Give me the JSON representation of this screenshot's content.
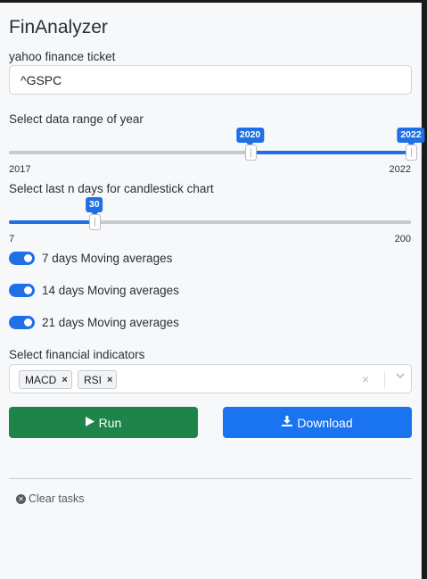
{
  "app": {
    "title": "FinAnalyzer"
  },
  "ticker": {
    "label": "yahoo finance ticket",
    "value": "^GSPC"
  },
  "year_range": {
    "label": "Select data range of year",
    "min": 2017,
    "max": 2022,
    "value_low": 2020,
    "value_high": 2022,
    "min_label": "2017",
    "max_label": "2022",
    "low_label": "2020",
    "high_label": "2022"
  },
  "days": {
    "label": "Select last n days for candlestick chart",
    "min": 7,
    "max": 200,
    "value": 30,
    "min_label": "7",
    "max_label": "200",
    "value_label": "30"
  },
  "toggles": [
    {
      "label": "7 days Moving averages",
      "checked": true
    },
    {
      "label": "14 days Moving averages",
      "checked": true
    },
    {
      "label": "21 days Moving averages",
      "checked": true
    }
  ],
  "indicators": {
    "label": "Select financial indicators",
    "selected": [
      "MACD",
      "RSI"
    ],
    "clear_glyph": "×",
    "arrow_glyph": "⌄",
    "remove_glyph": "×"
  },
  "actions": {
    "run_label": "Run",
    "run_icon": "play-icon",
    "download_label": "Download",
    "download_icon": "download-icon"
  },
  "tasks": {
    "clear_label": "Clear tasks"
  },
  "colors": {
    "accent": "#1f6fe5",
    "run": "#1e8449",
    "download": "#1a73f0"
  }
}
